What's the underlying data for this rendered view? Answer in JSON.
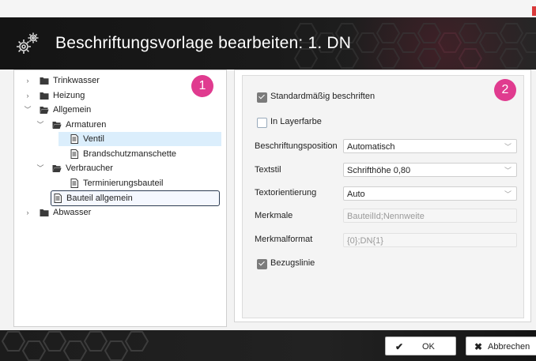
{
  "window": {
    "title": "Beschriftungsvorlage bearbeiten: 1. DN"
  },
  "badges": {
    "left": "1",
    "right": "2"
  },
  "tree": [
    {
      "label": "Trinkwasser",
      "level": 0,
      "type": "folder",
      "expander": "collapsed"
    },
    {
      "label": "Heizung",
      "level": 0,
      "type": "folder",
      "expander": "collapsed"
    },
    {
      "label": "Allgemein",
      "level": 0,
      "type": "folder-open",
      "expander": "expanded"
    },
    {
      "label": "Armaturen",
      "level": 1,
      "type": "folder-open",
      "expander": "expanded"
    },
    {
      "label": "Ventil",
      "level": 2,
      "type": "doc",
      "expander": "none",
      "selected": true
    },
    {
      "label": "Brandschutzmanschette",
      "level": 2,
      "type": "doc",
      "expander": "none"
    },
    {
      "label": "Verbraucher",
      "level": 1,
      "type": "folder-open",
      "expander": "expanded"
    },
    {
      "label": "Terminierungsbauteil",
      "level": 2,
      "type": "doc",
      "expander": "none"
    },
    {
      "label": "Bauteil allgemein",
      "level": 1,
      "type": "doc",
      "expander": "none",
      "focused": true
    },
    {
      "label": "Abwasser",
      "level": 0,
      "type": "folder",
      "expander": "collapsed"
    }
  ],
  "options": {
    "standard_label": "Standardmäßig beschriften",
    "standard_checked": true,
    "layer_label": "In Layerfarbe",
    "layer_checked": false,
    "bezug_label": "Bezugslinie",
    "bezug_checked": true
  },
  "fields": {
    "position_label": "Beschriftungsposition",
    "position_value": "Automatisch",
    "textstil_label": "Textstil",
    "textstil_value": "Schrifthöhe 0,80",
    "orient_label": "Textorientierung",
    "orient_value": "Auto",
    "merkmale_label": "Merkmale",
    "merkmale_value": "BauteilId;Nennweite",
    "format_label": "Merkmalformat",
    "format_value": "{0};DN{1}"
  },
  "buttons": {
    "ok_label": "OK",
    "cancel_label": "Abbrechen"
  },
  "colors": {
    "accent_badge": "#e03b8f",
    "selection": "#dbeefc",
    "header_bg": "#1a1a1a"
  }
}
